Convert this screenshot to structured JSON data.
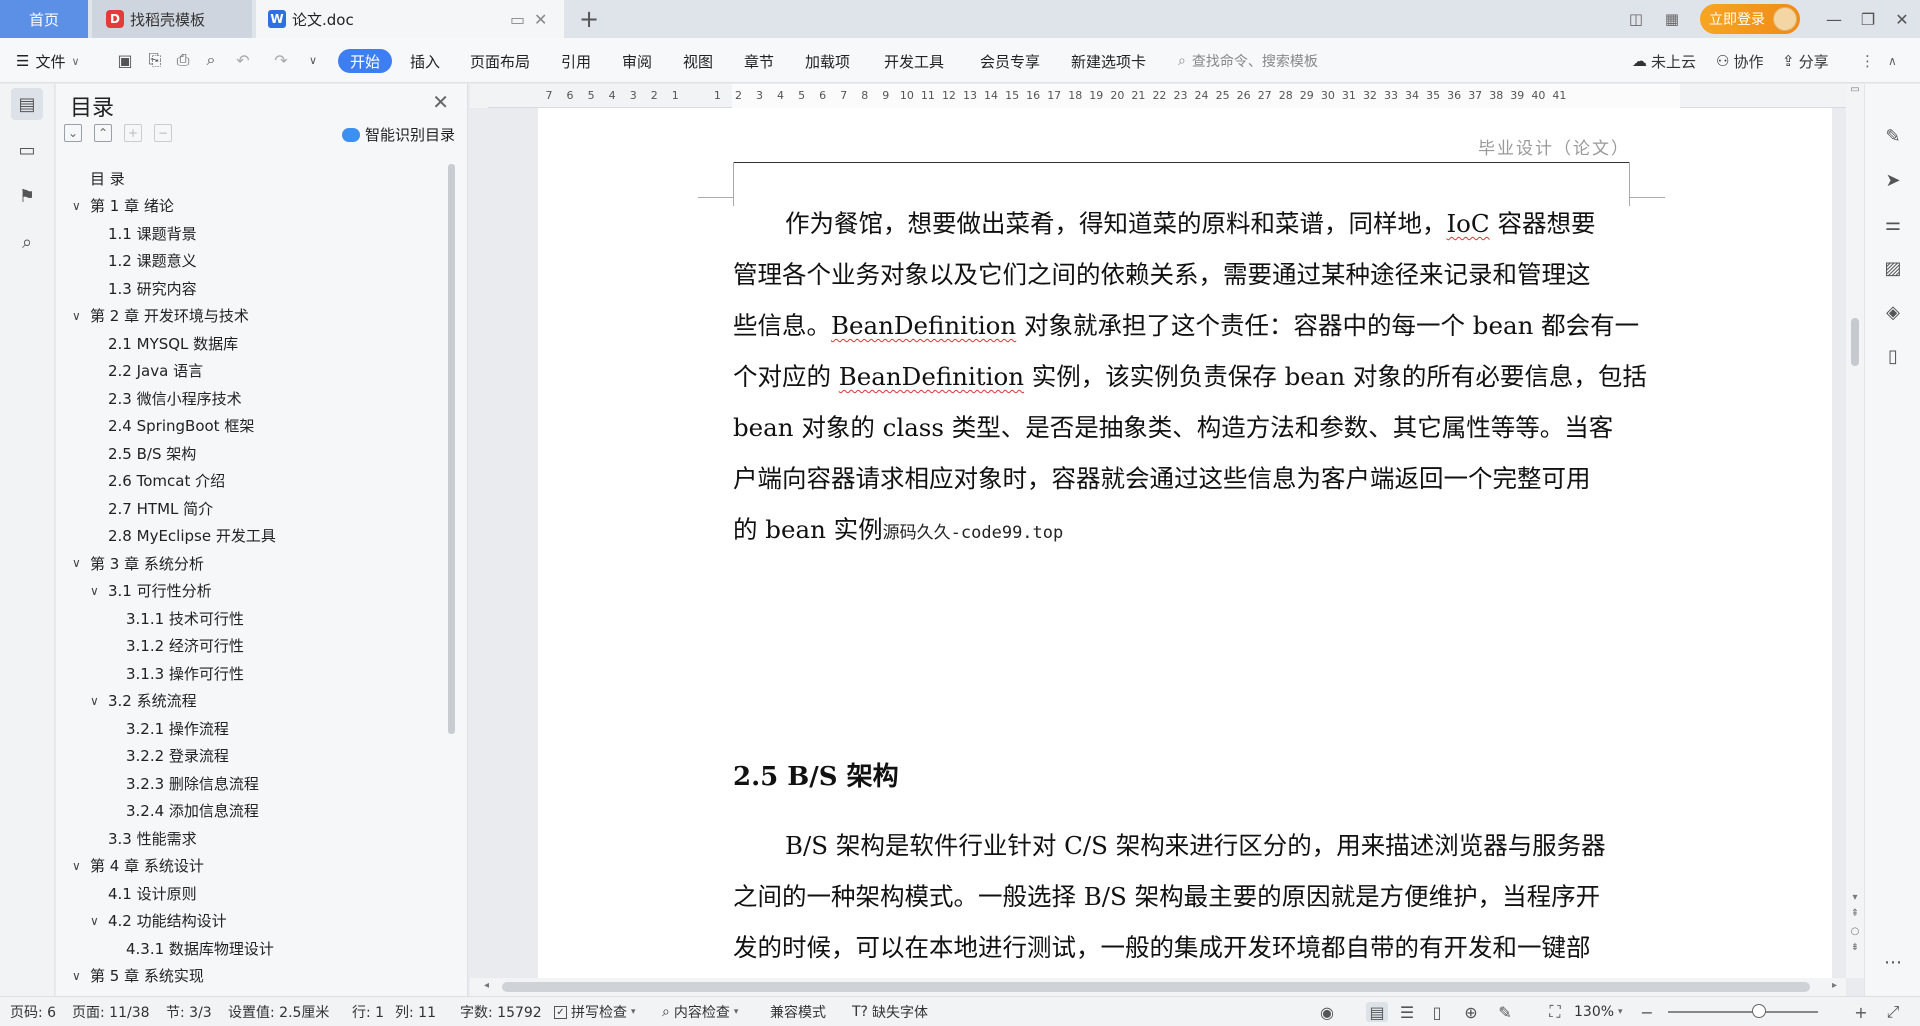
{
  "tabs": {
    "home": "首页",
    "template": "找稻壳模板",
    "document": "论文.doc"
  },
  "titlebar": {
    "login": "立即登录"
  },
  "menu": {
    "file": "文件",
    "items": [
      "开始",
      "插入",
      "页面布局",
      "引用",
      "审阅",
      "视图",
      "章节",
      "加载项",
      "开发工具",
      "会员专享",
      "新建选项卡"
    ],
    "search_placeholder": "查找命令、搜索模板",
    "cloud": "未上云",
    "collab": "协作",
    "share": "分享"
  },
  "toc": {
    "title": "目录",
    "smart": "智能识别目录",
    "items": [
      {
        "label": "目  录",
        "level": 0,
        "chev": ""
      },
      {
        "label": "第 1 章  绪论",
        "level": 0,
        "chev": "v"
      },
      {
        "label": "1.1  课题背景",
        "level": 1,
        "chev": ""
      },
      {
        "label": "1.2  课题意义",
        "level": 1,
        "chev": ""
      },
      {
        "label": "1.3  研究内容",
        "level": 1,
        "chev": ""
      },
      {
        "label": "第 2 章  开发环境与技术",
        "level": 0,
        "chev": "v"
      },
      {
        "label": "2.1  MYSQL 数据库",
        "level": 1,
        "chev": ""
      },
      {
        "label": "2.2  Java 语言",
        "level": 1,
        "chev": ""
      },
      {
        "label": "2.3  微信小程序技术",
        "level": 1,
        "chev": ""
      },
      {
        "label": "2.4  SpringBoot 框架",
        "level": 1,
        "chev": ""
      },
      {
        "label": "2.5  B/S 架构",
        "level": 1,
        "chev": ""
      },
      {
        "label": "2.6  Tomcat  介绍",
        "level": 1,
        "chev": ""
      },
      {
        "label": "2.7  HTML 简介",
        "level": 1,
        "chev": ""
      },
      {
        "label": "2.8  MyEclipse 开发工具",
        "level": 1,
        "chev": ""
      },
      {
        "label": "第 3 章  系统分析",
        "level": 0,
        "chev": "v"
      },
      {
        "label": "3.1  可行性分析",
        "level": 1,
        "chev": "v"
      },
      {
        "label": "3.1.1  技术可行性",
        "level": 2,
        "chev": ""
      },
      {
        "label": "3.1.2  经济可行性",
        "level": 2,
        "chev": ""
      },
      {
        "label": "3.1.3  操作可行性",
        "level": 2,
        "chev": ""
      },
      {
        "label": "3.2  系统流程",
        "level": 1,
        "chev": "v"
      },
      {
        "label": "3.2.1  操作流程",
        "level": 2,
        "chev": ""
      },
      {
        "label": "3.2.2  登录流程",
        "level": 2,
        "chev": ""
      },
      {
        "label": "3.2.3  删除信息流程",
        "level": 2,
        "chev": ""
      },
      {
        "label": "3.2.4  添加信息流程",
        "level": 2,
        "chev": ""
      },
      {
        "label": "3.3  性能需求",
        "level": 1,
        "chev": ""
      },
      {
        "label": "第 4 章  系统设计",
        "level": 0,
        "chev": "v"
      },
      {
        "label": "4.1  设计原则",
        "level": 1,
        "chev": ""
      },
      {
        "label": "4.2  功能结构设计",
        "level": 1,
        "chev": "v"
      },
      {
        "label": "4.3.1  数据库物理设计",
        "level": 2,
        "chev": ""
      },
      {
        "label": "第 5 章  系统实现",
        "level": 0,
        "chev": "v"
      }
    ]
  },
  "ruler": {
    "ticks": [
      "7",
      "6",
      "5",
      "4",
      "3",
      "2",
      "1",
      "",
      "1",
      "2",
      "3",
      "4",
      "5",
      "6",
      "7",
      "8",
      "9",
      "10",
      "11",
      "12",
      "13",
      "14",
      "15",
      "16",
      "17",
      "18",
      "19",
      "20",
      "21",
      "22",
      "23",
      "24",
      "25",
      "26",
      "27",
      "28",
      "29",
      "30",
      "31",
      "32",
      "33",
      "34",
      "35",
      "36",
      "37",
      "38",
      "39",
      "40",
      "41"
    ]
  },
  "document": {
    "header": "毕业设计（论文）",
    "para1": {
      "l1a": "作为餐馆，想要做出菜肴，得知道菜的原料和菜谱，同样地，",
      "l1b": "IoC",
      "l1c": " 容器想要",
      "l2": "管理各个业务对象以及它们之间的依赖关系，需要通过某种途径来记录和管理这",
      "l3a": "些信息。",
      "l3b": "BeanDefinition",
      "l3c": " 对象就承担了这个责任：容器中的每一个 bean 都会有一",
      "l4a": "个对应的 ",
      "l4b": "BeanDefinition",
      "l4c": " 实例，该实例负责保存 bean 对象的所有必要信息，包括",
      "l5": "bean 对象的 class 类型、是否是抽象类、构造方法和参数、其它属性等等。当客",
      "l6": "户端向容器请求相应对象时，容器就会通过这些信息为客户端返回一个完整可用",
      "l7": "的 bean 实例",
      "watermark": "源码久久-code99.top"
    },
    "heading": "2.5 B/S 架构",
    "para2": {
      "l1": "B/S 架构是软件行业针对 C/S 架构来进行区分的，用来描述浏览器与服务器",
      "l2": "之间的一种架构模式。一般选择 B/S 架构最主要的原因就是方便维护，当程序开",
      "l3": "发的时候，可以在本地进行测试，一般的集成开发环境都自带的有开发和一键部"
    }
  },
  "status": {
    "page_code": "页码: 6",
    "page": "页面: 11/38",
    "section": "节: 3/3",
    "setting": "设置值: 2.5厘米",
    "row": "行: 1",
    "col": "列: 11",
    "words": "字数: 15792",
    "spell": "拼写检查",
    "content_check": "内容检查",
    "compat": "兼容模式",
    "missing_font": "缺失字体",
    "zoom": "130%"
  }
}
